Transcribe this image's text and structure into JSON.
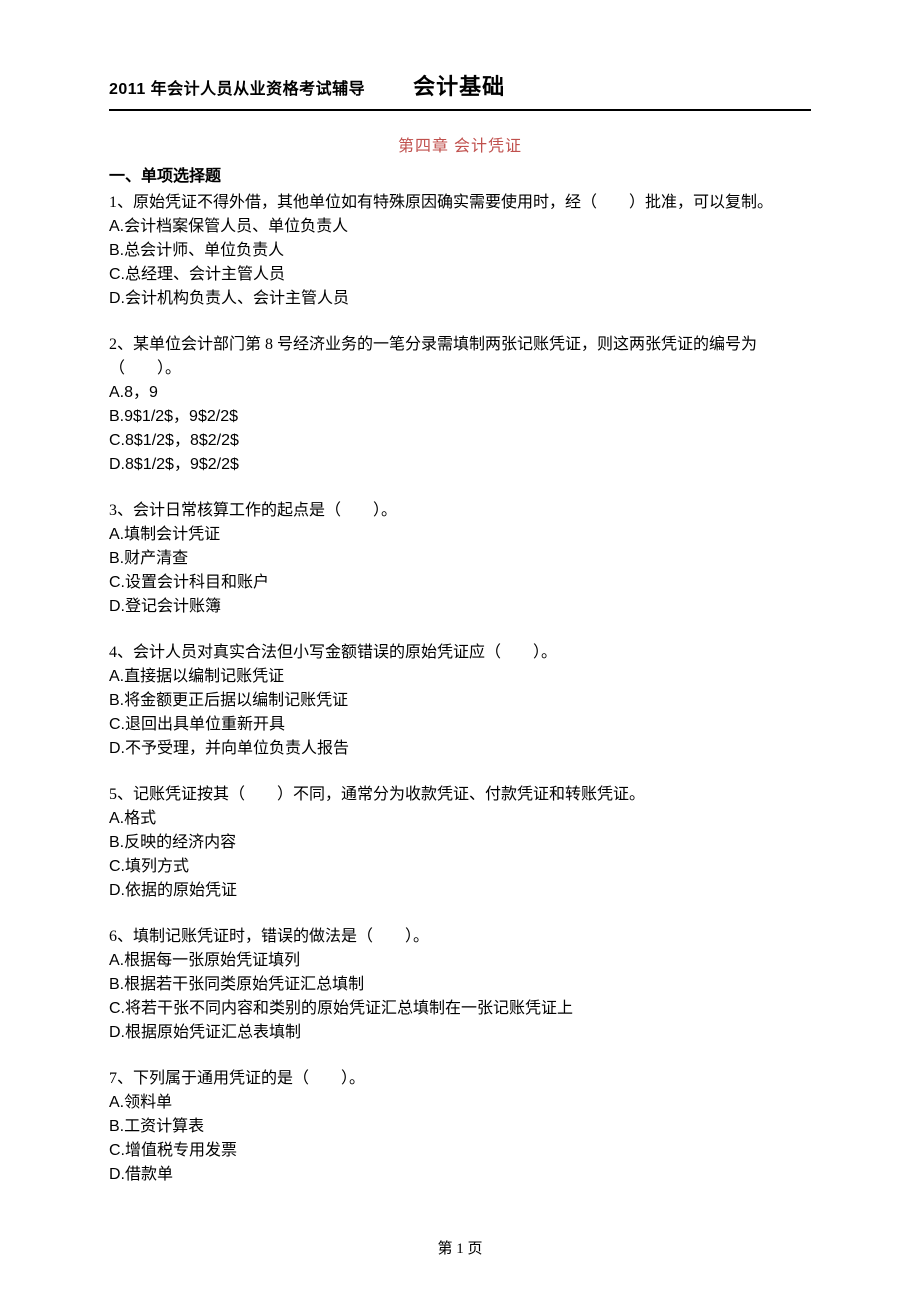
{
  "header": {
    "left": "2011 年会计人员从业资格考试辅导",
    "right": "会计基础"
  },
  "chapter_title": "第四章  会计凭证",
  "section_heading": "一、单项选择题",
  "questions": [
    {
      "text": "1、原始凭证不得外借，其他单位如有特殊原因确实需要使用时，经（　　）批准，可以复制。",
      "options": [
        "A.会计档案保管人员、单位负责人",
        "B.总会计师、单位负责人",
        "C.总经理、会计主管人员",
        "D.会计机构负责人、会计主管人员"
      ]
    },
    {
      "text": "2、某单位会计部门第 8 号经济业务的一笔分录需填制两张记账凭证，则这两张凭证的编号为（　　）。",
      "options": [
        "A.8，9",
        "B.9$1/2$，9$2/2$",
        "C.8$1/2$，8$2/2$",
        "D.8$1/2$，9$2/2$"
      ]
    },
    {
      "text": "3、会计日常核算工作的起点是（　　）。",
      "options": [
        "A.填制会计凭证",
        "B.财产清查",
        "C.设置会计科目和账户",
        "D.登记会计账簿"
      ]
    },
    {
      "text": "4、会计人员对真实合法但小写金额错误的原始凭证应（　　）。",
      "options": [
        "A.直接据以编制记账凭证",
        "B.将金额更正后据以编制记账凭证",
        "C.退回出具单位重新开具",
        "D.不予受理，并向单位负责人报告"
      ]
    },
    {
      "text": "5、记账凭证按其（　　）不同，通常分为收款凭证、付款凭证和转账凭证。",
      "options": [
        "A.格式",
        "B.反映的经济内容",
        "C.填列方式",
        "D.依据的原始凭证"
      ]
    },
    {
      "text": "6、填制记账凭证时，错误的做法是（　　）。",
      "options": [
        "A.根据每一张原始凭证填列",
        "B.根据若干张同类原始凭证汇总填制",
        "C.将若干张不同内容和类别的原始凭证汇总填制在一张记账凭证上",
        "D.根据原始凭证汇总表填制"
      ]
    },
    {
      "text": "7、下列属于通用凭证的是（　　）。",
      "options": [
        "A.领料单",
        "B.工资计算表",
        "C.增值税专用发票",
        "D.借款单"
      ]
    }
  ],
  "footer": "第 1 页"
}
